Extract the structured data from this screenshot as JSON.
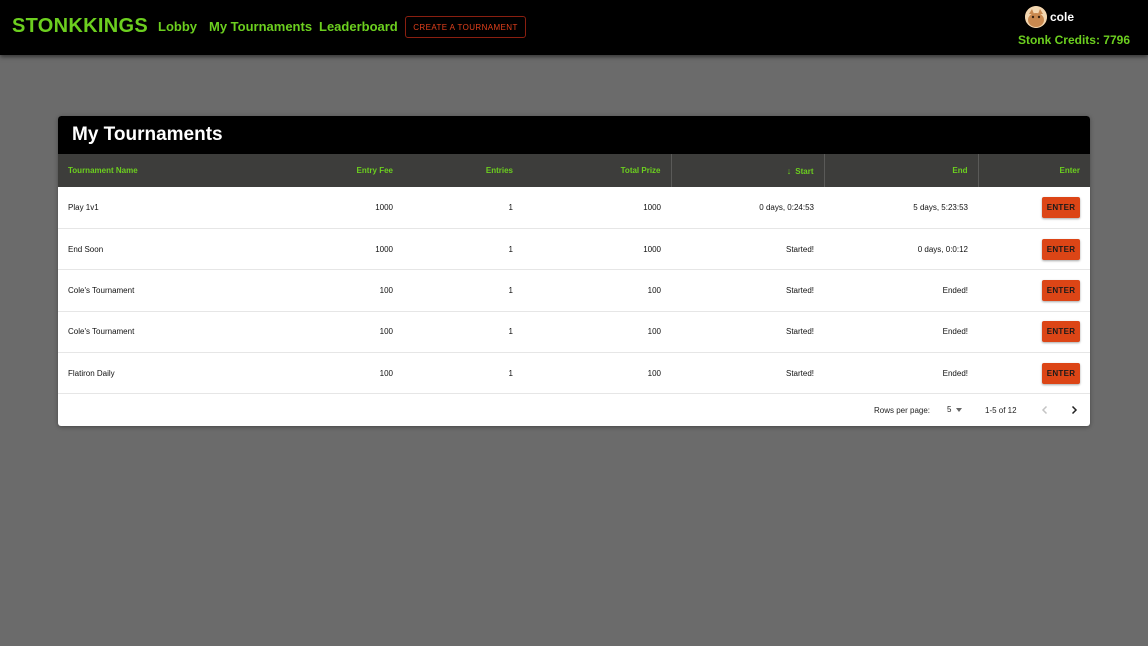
{
  "header": {
    "brand": "STONKKINGS",
    "nav": [
      "Lobby",
      "My Tournaments",
      "Leaderboard"
    ],
    "create_button": "CREATE A TOURNAMENT",
    "username": "cole",
    "credits_label": "Stonk Credits: 7796"
  },
  "panel": {
    "title": "My Tournaments",
    "columns": [
      "Tournament Name",
      "Entry Fee",
      "Entries",
      "Total Prize",
      "Start",
      "End",
      "Enter"
    ],
    "sort_column": "Start",
    "rows": [
      {
        "name": "Play 1v1",
        "fee": "1000",
        "entries": "1",
        "prize": "1000",
        "start": "0 days, 0:24:53",
        "end": "5 days, 5:23:53",
        "action": "ENTER"
      },
      {
        "name": "End Soon",
        "fee": "1000",
        "entries": "1",
        "prize": "1000",
        "start": "Started!",
        "end": "0 days, 0:0:12",
        "action": "ENTER"
      },
      {
        "name": "Cole's Tournament",
        "fee": "100",
        "entries": "1",
        "prize": "100",
        "start": "Started!",
        "end": "Ended!",
        "action": "ENTER"
      },
      {
        "name": "Cole's Tournament",
        "fee": "100",
        "entries": "1",
        "prize": "100",
        "start": "Started!",
        "end": "Ended!",
        "action": "ENTER"
      },
      {
        "name": "Flatiron Daily",
        "fee": "100",
        "entries": "1",
        "prize": "100",
        "start": "Started!",
        "end": "Ended!",
        "action": "ENTER"
      }
    ],
    "pagination": {
      "rows_per_page_label": "Rows per page:",
      "rows_per_page": "5",
      "range": "1-5 of 12"
    }
  },
  "colors": {
    "accent_green": "#6ccf1f",
    "enter_button": "#dc4516",
    "background": "#6b6b6b"
  },
  "icons": [
    "avatar-image",
    "sort-arrow-down-icon",
    "dropdown-caret-icon",
    "chevron-left-icon",
    "chevron-right-icon"
  ]
}
